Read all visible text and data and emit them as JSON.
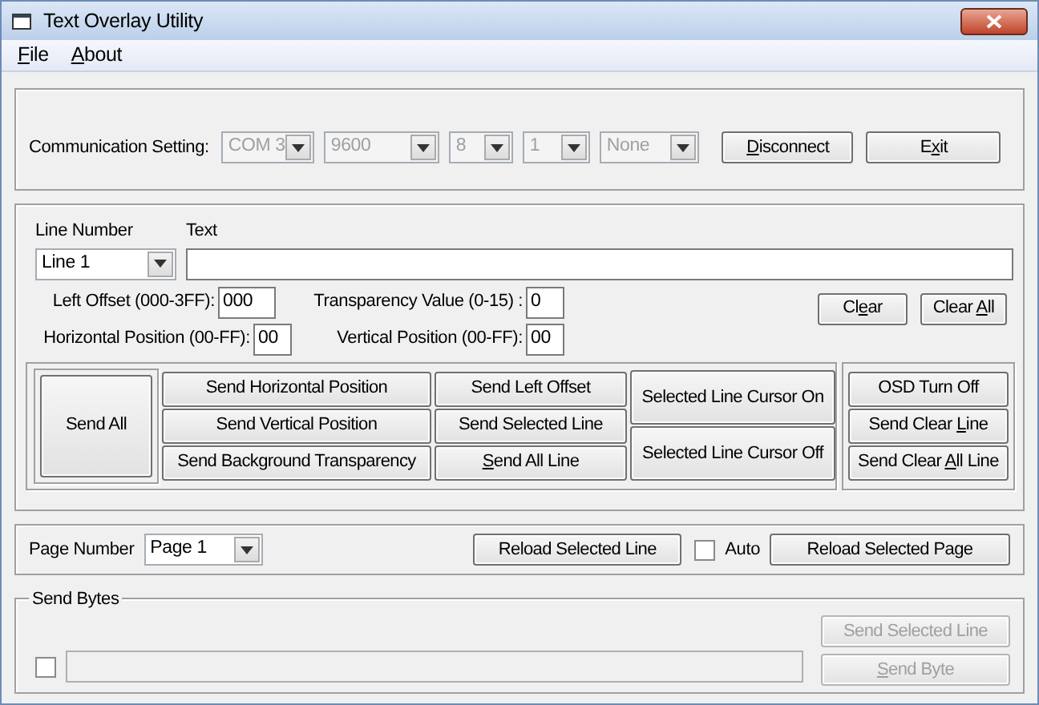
{
  "window": {
    "title": "Text Overlay Utility"
  },
  "menu": [
    {
      "label": [
        {
          "text": "F",
          "underlined": true
        },
        {
          "text": "ile",
          "underlined": false
        }
      ]
    },
    {
      "label": [
        {
          "text": "A",
          "underlined": true
        },
        {
          "text": "bout",
          "underlined": false
        }
      ]
    }
  ],
  "communication": {
    "label": "Communication Setting:",
    "selects": [
      {
        "value": "COM 3",
        "disabled": true
      },
      {
        "value": "9600",
        "disabled": true
      },
      {
        "value": "8",
        "disabled": true
      },
      {
        "value": "1",
        "disabled": true
      },
      {
        "value": "None",
        "disabled": true
      }
    ],
    "buttons": [
      {
        "label": [
          {
            "text": "D",
            "underlined": true
          },
          {
            "text": "isconnect",
            "underlined": false
          }
        ],
        "disabled": false
      },
      {
        "label": [
          {
            "text": "E",
            "underlined": false
          },
          {
            "text": "x",
            "underlined": true
          },
          {
            "text": "it",
            "underlined": false
          }
        ],
        "disabled": false
      }
    ]
  },
  "line_editor": {
    "line_number_label": "Line Number",
    "line_number": "Line 1",
    "text_label": "Text",
    "fields": [
      {
        "label": "Left Offset (000-3FF):",
        "value": "000"
      },
      {
        "label": "Transparency Value (0-15) :",
        "value": "0"
      },
      {
        "label": "Horizontal Position (00-FF):",
        "value": "00"
      },
      {
        "label": "Vertical Position (00-FF):",
        "value": "00"
      }
    ],
    "clear_buttons": [
      {
        "label": [
          {
            "text": "Cl",
            "underlined": false
          },
          {
            "text": "e",
            "underlined": true
          },
          {
            "text": "ar",
            "underlined": false
          }
        ],
        "disabled": false
      },
      {
        "label": [
          {
            "text": "Clear ",
            "underlined": false
          },
          {
            "text": "A",
            "underlined": true
          },
          {
            "text": "ll",
            "underlined": false
          }
        ],
        "disabled": false
      }
    ]
  },
  "send": {
    "send_all": {
      "label": "Send All",
      "disabled": false
    },
    "column_1": [
      {
        "label": "Send Horizontal Position",
        "disabled": false
      },
      {
        "label": "Send Vertical Position",
        "disabled": false
      },
      {
        "label": "Send Background Transparency",
        "disabled": false
      }
    ],
    "column_2": [
      {
        "label": "Send Left Offset",
        "disabled": false
      },
      {
        "label": "Send Selected Line",
        "disabled": false
      },
      {
        "label": [
          {
            "text": "S",
            "underlined": true
          },
          {
            "text": "end All Line",
            "underlined": false
          }
        ],
        "disabled": false
      }
    ],
    "column_3": [
      {
        "label": "Selected Line Cursor On",
        "disabled": false
      },
      {
        "label": "Selected Line Cursor Off",
        "disabled": false
      }
    ],
    "osd": [
      {
        "label": "OSD Turn Off",
        "disabled": false
      },
      {
        "label": [
          {
            "text": "Send Clear ",
            "underlined": false
          },
          {
            "text": "L",
            "underlined": true
          },
          {
            "text": "ine",
            "underlined": false
          }
        ],
        "disabled": false
      },
      {
        "label": [
          {
            "text": "Send Clear ",
            "underlined": false
          },
          {
            "text": "A",
            "underlined": true
          },
          {
            "text": "ll Line",
            "underlined": false
          }
        ],
        "disabled": false
      }
    ]
  },
  "page": {
    "label": "Page Number",
    "value": "Page 1",
    "buttons": [
      {
        "label": "Reload Selected Line",
        "disabled": false
      },
      {
        "label": "Reload Selected Page",
        "disabled": false
      }
    ],
    "auto": {
      "label": "Auto",
      "checked": false
    }
  },
  "send_bytes": {
    "title": "Send Bytes",
    "checked": false,
    "field_disabled": true,
    "buttons": [
      {
        "label": "Send Selected Line",
        "disabled": true
      },
      {
        "label": [
          {
            "text": "S",
            "underlined": true
          },
          {
            "text": "end Byte",
            "underlined": false
          }
        ],
        "disabled": true
      }
    ]
  }
}
